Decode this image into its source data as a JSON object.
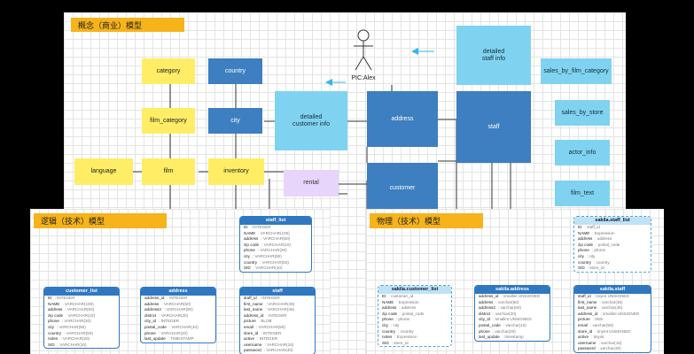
{
  "conceptual": {
    "title": "概念（商业）模型",
    "actor_label": "PIC:Alex",
    "entities": {
      "category": "category",
      "country": "country",
      "film_category": "film_category",
      "city": "city",
      "language": "language",
      "film": "film",
      "inventory": "inventory",
      "rental": "rental",
      "detailed_customer_info": "detailed\ncustomer info",
      "address": "address",
      "staff": "staff",
      "customer": "customer",
      "detailed_staff_info": "detailed\nstaff info",
      "sales_by_film_category": "sales_by_film_category",
      "sales_by_store": "sales_by_store",
      "actor_info": "actor_info",
      "film_text": "film_text"
    }
  },
  "logical": {
    "title": "逻辑（技术）模型",
    "tables": [
      {
        "name": "staff_list",
        "rows": [
          [
            "ID",
            "INTEGER"
          ],
          [
            "NAME",
            "VARCHAR(100)"
          ],
          [
            "address",
            "VARCHAR(50)"
          ],
          [
            "zip code",
            "VARCHAR(10)"
          ],
          [
            "phone",
            "VARCHAR(20)"
          ],
          [
            "city",
            "VARCHAR(50)"
          ],
          [
            "country",
            "VARCHAR(50)"
          ],
          [
            "SID",
            "VARCHAR(10)"
          ]
        ]
      },
      {
        "name": "customer_list",
        "rows": [
          [
            "ID",
            "INTEGER"
          ],
          [
            "NAME",
            "VARCHAR(100)"
          ],
          [
            "address",
            "VARCHAR(50)"
          ],
          [
            "zip code",
            "VARCHAR(10)"
          ],
          [
            "phone",
            "VARCHAR(20)"
          ],
          [
            "city",
            "VARCHAR(50)"
          ],
          [
            "country",
            "VARCHAR(50)"
          ],
          [
            "notes",
            "VARCHAR(20)"
          ],
          [
            "SID",
            "VARCHAR(10)"
          ]
        ]
      },
      {
        "name": "address",
        "rows": [
          [
            "address_id",
            "INTEGER"
          ],
          [
            "address",
            "VARCHAR(50)"
          ],
          [
            "address2",
            "VARCHAR(50)"
          ],
          [
            "district",
            "VARCHAR(20)"
          ],
          [
            "city_id",
            "INTEGER"
          ],
          [
            "postal_code",
            "VARCHAR(10)"
          ],
          [
            "phone",
            "VARCHAR(20)"
          ],
          [
            "last_update",
            "TIMESTAMP"
          ]
        ]
      },
      {
        "name": "staff",
        "rows": [
          [
            "staff_id",
            "INTEGER"
          ],
          [
            "first_name",
            "VARCHAR(45)"
          ],
          [
            "last_name",
            "VARCHAR(45)"
          ],
          [
            "address_id",
            "INTEGER"
          ],
          [
            "picture",
            "BLOB"
          ],
          [
            "email",
            "VARCHAR(50)"
          ],
          [
            "store_id",
            "INTEGER"
          ],
          [
            "active",
            "INTEGER"
          ],
          [
            "username",
            "VARCHAR(16)"
          ],
          [
            "password",
            "VARCHAR(40)"
          ]
        ]
      }
    ]
  },
  "physical": {
    "title": "物理（技术）模型",
    "tables": [
      {
        "name": "sakila.staff_list",
        "rows": [
          [
            "ID",
            "staff_id"
          ],
          [
            "NAME",
            "Expression"
          ],
          [
            "address",
            "address"
          ],
          [
            "zip code",
            "postal_code"
          ],
          [
            "phone",
            "phone"
          ],
          [
            "city",
            "city"
          ],
          [
            "country",
            "country"
          ],
          [
            "SID",
            "store_id"
          ]
        ]
      },
      {
        "name": "sakila.customer_list",
        "rows": [
          [
            "ID",
            "customer_id"
          ],
          [
            "NAME",
            "Expression"
          ],
          [
            "address",
            "address"
          ],
          [
            "zip code",
            "postal_code"
          ],
          [
            "phone",
            "phone"
          ],
          [
            "city",
            "city"
          ],
          [
            "country",
            "country"
          ],
          [
            "notes",
            "Expression"
          ],
          [
            "SID",
            "store_id"
          ]
        ]
      },
      {
        "name": "sakila.address",
        "rows": [
          [
            "address_id",
            "smallint UNSIGNED"
          ],
          [
            "address",
            "varchar(50)"
          ],
          [
            "address2",
            "varchar(50)"
          ],
          [
            "district",
            "varchar(20)"
          ],
          [
            "city_id",
            "smallint UNSIGNED"
          ],
          [
            "postal_code",
            "varchar(10)"
          ],
          [
            "phone",
            "varchar(20)"
          ],
          [
            "last_update",
            "timestamp"
          ]
        ]
      },
      {
        "name": "sakila.staff",
        "rows": [
          [
            "staff_id",
            "tinyint UNSIGNED"
          ],
          [
            "first_name",
            "varchar(45)"
          ],
          [
            "last_name",
            "varchar(45)"
          ],
          [
            "address_id",
            "smallint UNSIGNED"
          ],
          [
            "picture",
            "blob"
          ],
          [
            "email",
            "varchar(50)"
          ],
          [
            "store_id",
            "tinyint UNSIGNED"
          ],
          [
            "active",
            "tinyint"
          ],
          [
            "username",
            "varchar(16)"
          ],
          [
            "password",
            "varchar(40)"
          ]
        ]
      }
    ]
  }
}
